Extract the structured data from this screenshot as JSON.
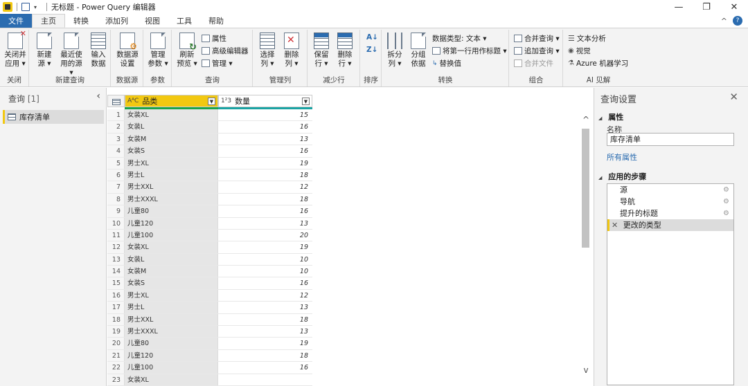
{
  "window": {
    "title": "无标题 - Power Query 编辑器",
    "qat_dropdown": "▾",
    "controls": {
      "minimize": "—",
      "restore": "❐",
      "close": "✕"
    }
  },
  "tabs": [
    {
      "label": "文件"
    },
    {
      "label": "主页"
    },
    {
      "label": "转换"
    },
    {
      "label": "添加列"
    },
    {
      "label": "视图"
    },
    {
      "label": "工具"
    },
    {
      "label": "帮助"
    }
  ],
  "tab_right": {
    "collapse": "^",
    "help": "?"
  },
  "ribbon": {
    "groups": [
      {
        "label": "关闭"
      },
      {
        "label": "新建查询"
      },
      {
        "label": "数据源"
      },
      {
        "label": "参数"
      },
      {
        "label": "查询"
      },
      {
        "label": "管理列"
      },
      {
        "label": "减少行"
      },
      {
        "label": "排序"
      },
      {
        "label": "转换"
      },
      {
        "label": "组合"
      },
      {
        "label": "AI 见解"
      }
    ],
    "close_apply": "关闭并\n应用 ▾",
    "new_source": "新建\n源 ▾",
    "recent_sources": "最近使\n用的源 ▾",
    "enter_data": "输入\n数据",
    "data_source_settings": "数据源\n设置",
    "manage_params": "管理\n参数 ▾",
    "refresh_preview": "刷新\n预览 ▾",
    "properties": "属性",
    "advanced_editor": "高级编辑器",
    "manage": "管理 ▾",
    "choose_columns": "选择\n列 ▾",
    "remove_columns": "删除\n列 ▾",
    "keep_rows": "保留\n行 ▾",
    "remove_rows": "删除\n行 ▾",
    "sort_asc": "A↓",
    "sort_desc": "Z↓",
    "split_column": "拆分\n列 ▾",
    "group_by": "分组\n依据",
    "data_type": "数据类型: 文本 ▾",
    "use_first_row": "将第一行用作标题 ▾",
    "replace_values": "替换值",
    "merge_queries": "合并查询 ▾",
    "append_queries": "追加查询 ▾",
    "combine_files": "合并文件",
    "text_analytics": "文本分析",
    "vision": "视觉",
    "azure_ml": "Azure 机器学习"
  },
  "queries_panel": {
    "title": "查询",
    "count": "[1]",
    "collapse": "‹",
    "items": [
      {
        "name": "库存清单"
      }
    ]
  },
  "grid": {
    "columns": [
      {
        "type": "AᴬC",
        "name": "品类"
      },
      {
        "type": "1²3",
        "name": "数量"
      }
    ],
    "rows": [
      {
        "n": "1",
        "cat": "女装XL",
        "qty": "15"
      },
      {
        "n": "2",
        "cat": "女装L",
        "qty": "16"
      },
      {
        "n": "3",
        "cat": "女装M",
        "qty": "13"
      },
      {
        "n": "4",
        "cat": "女装S",
        "qty": "16"
      },
      {
        "n": "5",
        "cat": "男士XL",
        "qty": "19"
      },
      {
        "n": "6",
        "cat": "男士L",
        "qty": "18"
      },
      {
        "n": "7",
        "cat": "男士XXL",
        "qty": "12"
      },
      {
        "n": "8",
        "cat": "男士XXXL",
        "qty": "18"
      },
      {
        "n": "9",
        "cat": "儿童80",
        "qty": "16"
      },
      {
        "n": "10",
        "cat": "儿童120",
        "qty": "13"
      },
      {
        "n": "11",
        "cat": "儿童100",
        "qty": "20"
      },
      {
        "n": "12",
        "cat": "女装XL",
        "qty": "19"
      },
      {
        "n": "13",
        "cat": "女装L",
        "qty": "10"
      },
      {
        "n": "14",
        "cat": "女装M",
        "qty": "10"
      },
      {
        "n": "15",
        "cat": "女装S",
        "qty": "16"
      },
      {
        "n": "16",
        "cat": "男士XL",
        "qty": "12"
      },
      {
        "n": "17",
        "cat": "男士L",
        "qty": "13"
      },
      {
        "n": "18",
        "cat": "男士XXL",
        "qty": "18"
      },
      {
        "n": "19",
        "cat": "男士XXXL",
        "qty": "13"
      },
      {
        "n": "20",
        "cat": "儿童80",
        "qty": "19"
      },
      {
        "n": "21",
        "cat": "儿童120",
        "qty": "18"
      },
      {
        "n": "22",
        "cat": "儿童100",
        "qty": "16"
      },
      {
        "n": "23",
        "cat": "女装XL",
        "qty": ""
      }
    ]
  },
  "scrollbar": {
    "up": "^",
    "down": "v"
  },
  "settings": {
    "title": "查询设置",
    "close": "✕",
    "properties_heading": "属性",
    "name_label": "名称",
    "name_value": "库存清单",
    "all_properties": "所有属性",
    "steps_heading": "应用的步骤",
    "steps": [
      {
        "label": "源",
        "gear": "⚙"
      },
      {
        "label": "导航",
        "gear": "⚙"
      },
      {
        "label": "提升的标题",
        "gear": "⚙"
      },
      {
        "label": "更改的类型",
        "gear": ""
      }
    ],
    "selected_step_marker": "✕"
  },
  "colors": {
    "file_tab": "#2b6cb0",
    "active_column": "#f2c811",
    "quality_bar": "#1aa34a",
    "link": "#2b6cb0"
  }
}
